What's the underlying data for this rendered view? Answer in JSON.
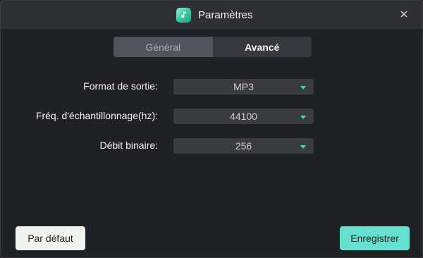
{
  "window": {
    "title": "Paramètres"
  },
  "tabs": [
    {
      "label": "Général",
      "active": true
    },
    {
      "label": "Avancé",
      "active": false
    }
  ],
  "settings": {
    "format": {
      "label": "Format de sortie:",
      "value": "MP3"
    },
    "sample_rate": {
      "label": "Fréq. d'échantillonnage(hz):",
      "value": "44100"
    },
    "bitrate": {
      "label": "Débit binaire:",
      "value": "256"
    }
  },
  "buttons": {
    "default_label": "Par défaut",
    "save_label": "Enregistrer"
  },
  "colors": {
    "accent": "#67e1cf",
    "window_bg": "#202124",
    "titlebar_bg": "#2f3033"
  },
  "icons": {
    "app": "music-note-icon",
    "close": "close-icon",
    "dropdown": "chevron-down-icon"
  }
}
